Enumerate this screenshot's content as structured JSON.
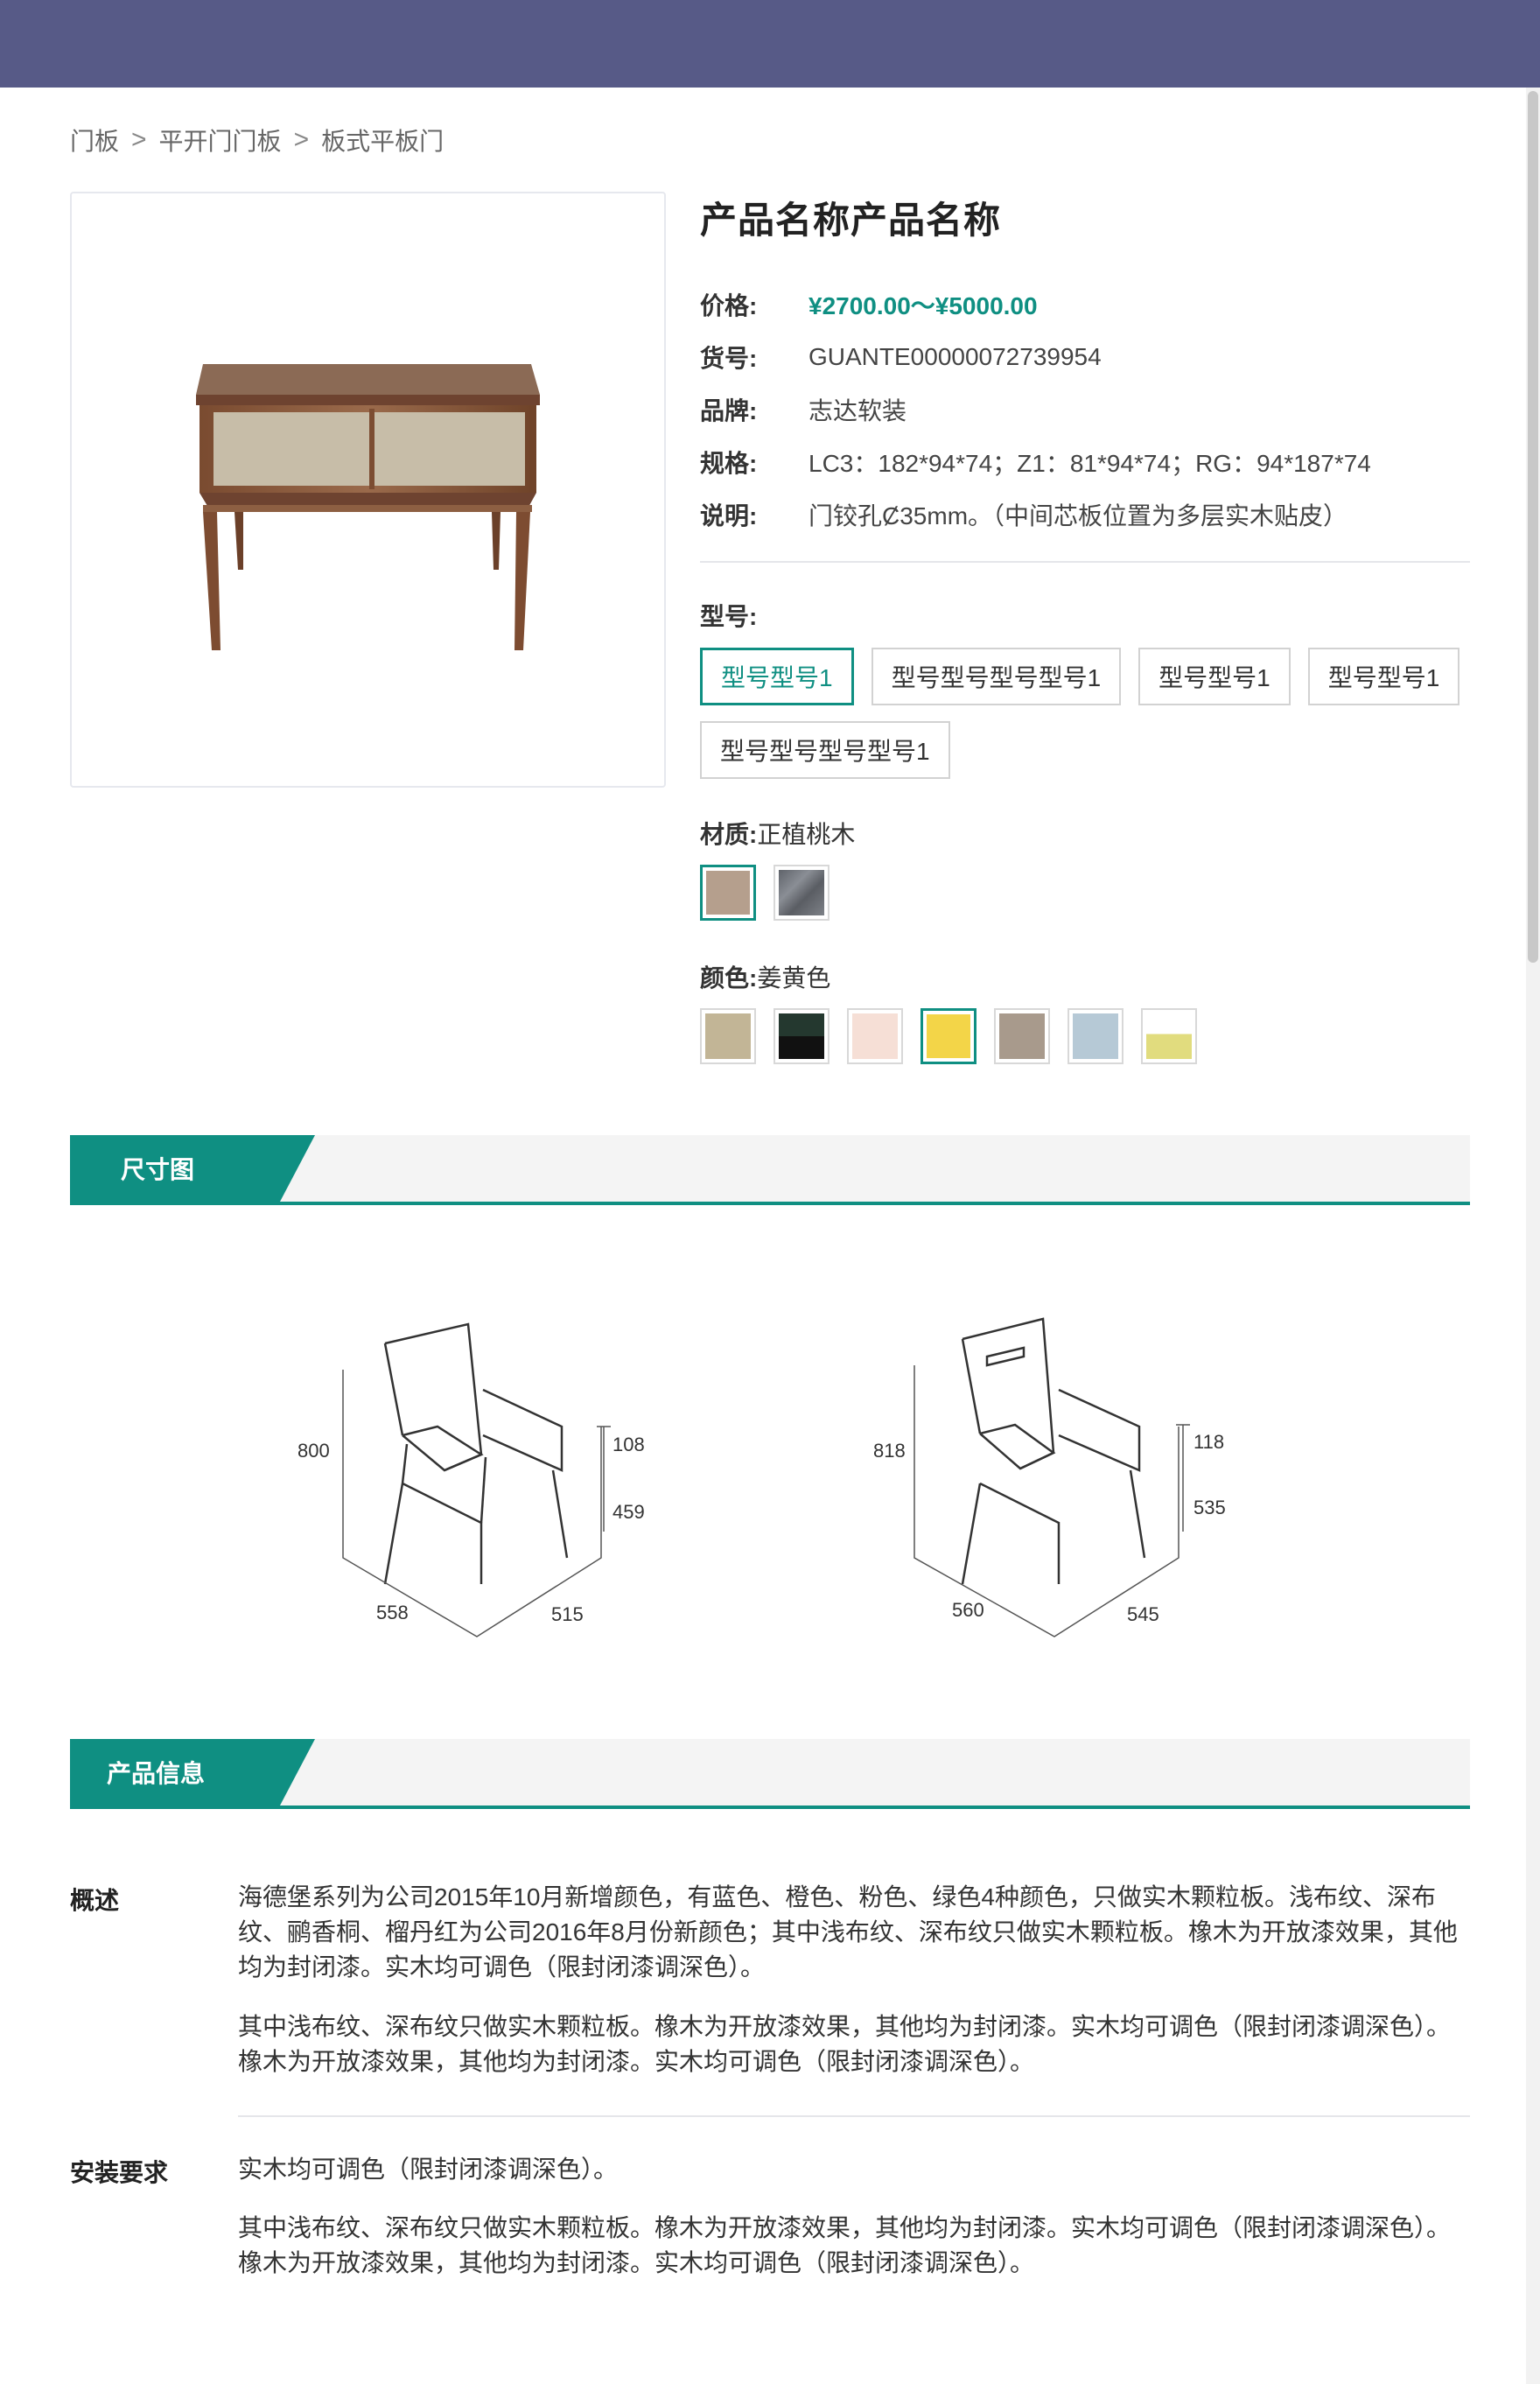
{
  "breadcrumb": {
    "items": [
      "门板",
      "平开门门板",
      "板式平板门"
    ],
    "separator": ">"
  },
  "product": {
    "title": "产品名称产品名称",
    "fields": [
      {
        "key": "价格:",
        "value": "¥2700.00～¥5000.00",
        "highlight": true
      },
      {
        "key": "货号:",
        "value": "GUANTE00000072739954"
      },
      {
        "key": "品牌:",
        "value": "志达软装"
      },
      {
        "key": "规格:",
        "value": "LC3：182*94*74；Z1：81*94*74；RG：94*187*74"
      },
      {
        "key": "说明:",
        "value": "门铰孔Ȼ35mm。（中间芯板位置为多层实木贴皮）"
      }
    ]
  },
  "model": {
    "label": "型号:",
    "options": [
      "型号型号1",
      "型号型号型号型号1",
      "型号型号1",
      "型号型号1",
      "型号型号型号型号1"
    ],
    "selected_index": 0
  },
  "material": {
    "label": "材质:",
    "value": "正植桃木",
    "swatches": [
      {
        "name": "walnut-wood-swatch",
        "color": "#b59f8d",
        "selected": true
      },
      {
        "name": "grey-stone-swatch",
        "color": "#777b82",
        "selected": false
      }
    ]
  },
  "color": {
    "label": "颜色:",
    "value": "姜黄色",
    "swatches": [
      {
        "name": "beige-swatch",
        "color": "#c2b596"
      },
      {
        "name": "dark-green-swatch",
        "color": "#1d2b28"
      },
      {
        "name": "pink-swatch",
        "color": "#f6dfd6"
      },
      {
        "name": "yellow-swatch",
        "color": "#f3d548",
        "selected": true
      },
      {
        "name": "taupe-swatch",
        "color": "#a89a8c"
      },
      {
        "name": "light-blue-swatch",
        "color": "#b6c9d6"
      },
      {
        "name": "lime-swatch",
        "color": "#e1dc7e"
      }
    ]
  },
  "sections": {
    "dimensions": "尺寸图",
    "product_info": "产品信息"
  },
  "diagram": {
    "chair1": {
      "height": "800",
      "arm": "108",
      "seat": "459",
      "depth": "558",
      "width": "515"
    },
    "chair2": {
      "height": "818",
      "arm": "118",
      "seat": "535",
      "depth": "560",
      "width": "545"
    }
  },
  "description": {
    "overview_label": "概述",
    "overview_p1": "海德堡系列为公司2015年10月新增颜色，有蓝色、橙色、粉色、绿色4种颜色，只做实木颗粒板。浅布纹、深布纹、鹂香桐、榴丹红为公司2016年8月份新颜色；其中浅布纹、深布纹只做实木颗粒板。橡木为开放漆效果，其他均为封闭漆。实木均可调色（限封闭漆调深色）。",
    "overview_p2": "其中浅布纹、深布纹只做实木颗粒板。橡木为开放漆效果，其他均为封闭漆。实木均可调色（限封闭漆调深色）。橡木为开放漆效果，其他均为封闭漆。实木均可调色（限封闭漆调深色）。",
    "install_label": "安装要求",
    "install_p1": "实木均可调色（限封闭漆调深色）。",
    "install_p2": "其中浅布纹、深布纹只做实木颗粒板。橡木为开放漆效果，其他均为封闭漆。实木均可调色（限封闭漆调深色）。橡木为开放漆效果，其他均为封闭漆。实木均可调色（限封闭漆调深色）。"
  },
  "colors": {
    "accent": "#0f8f82",
    "header": "#575a87"
  }
}
